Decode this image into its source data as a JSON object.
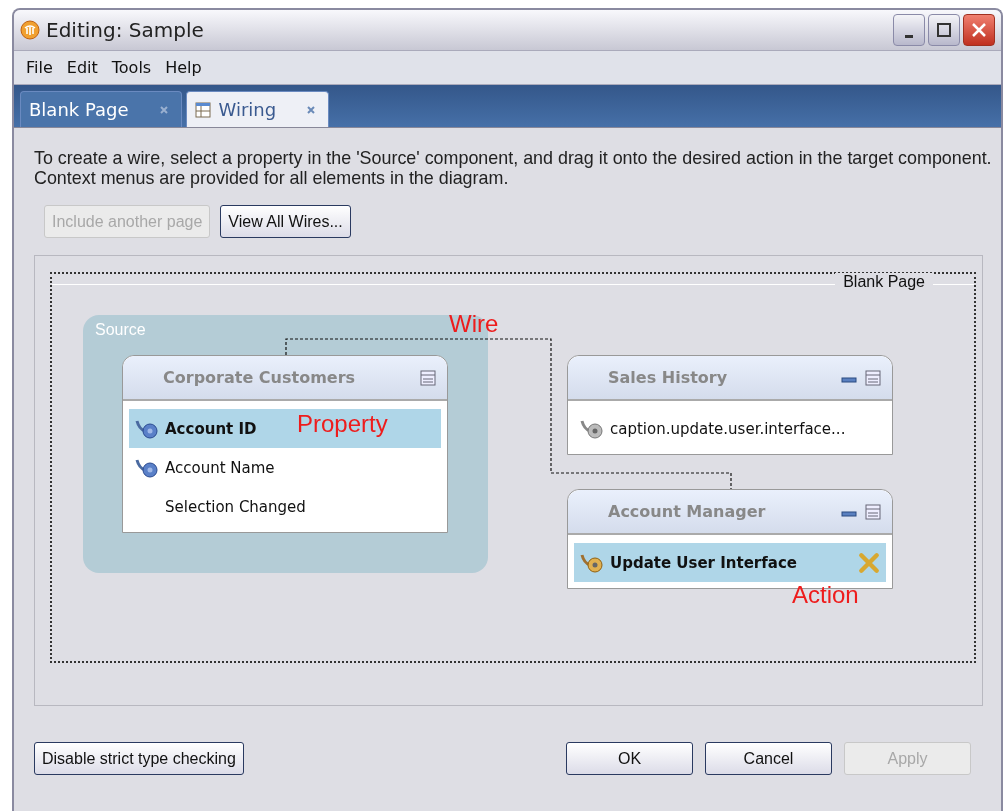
{
  "window": {
    "title": "Editing: Sample"
  },
  "menu": [
    "File",
    "Edit",
    "Tools",
    "Help"
  ],
  "tabs": [
    {
      "label": "Blank Page",
      "selected": false,
      "icon": false
    },
    {
      "label": "Wiring",
      "selected": true,
      "icon": true
    }
  ],
  "instructions": [
    "To create a wire, select a property in the 'Source' component, and drag it onto the desired action in the target component.",
    "Context menus are provided for all elements in the diagram."
  ],
  "toolbar": [
    {
      "label": "Include another page",
      "disabled": true
    },
    {
      "label": "View All Wires...",
      "disabled": false
    }
  ],
  "diagram": {
    "page_label": "Blank Page",
    "source_label": "Source",
    "components": [
      {
        "title": "Corporate Customers",
        "minimizable": false,
        "items": [
          {
            "kind": "property",
            "label": "Account ID",
            "selected": true
          },
          {
            "kind": "property",
            "label": "Account Name",
            "selected": false
          },
          {
            "kind": "event",
            "label": "Selection Changed",
            "selected": false
          }
        ]
      },
      {
        "title": "Sales History",
        "minimizable": true,
        "items": [
          {
            "kind": "action",
            "label": "caption.update.user.interface...",
            "selected": false
          }
        ]
      },
      {
        "title": "Account Manager",
        "minimizable": true,
        "items": [
          {
            "kind": "action",
            "label": "Update User Interface",
            "selected": true
          }
        ]
      }
    ],
    "annotations": [
      "Wire",
      "Property",
      "Action"
    ]
  },
  "buttons": [
    {
      "label": "Disable strict type checking",
      "disabled": false
    },
    {
      "label": "OK",
      "disabled": false
    },
    {
      "label": "Cancel",
      "disabled": false
    },
    {
      "label": "Apply",
      "disabled": true
    }
  ]
}
